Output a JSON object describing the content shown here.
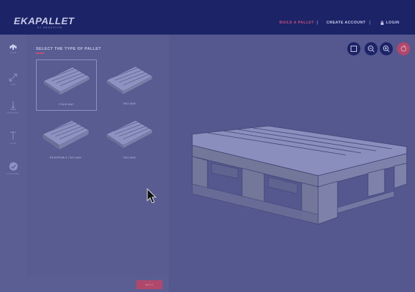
{
  "header": {
    "logo": "EKAPALLET",
    "logo_sub": "BY BRAGSTON",
    "nav": {
      "build": "BUILD A PALLET",
      "create": "CREATE ACCOUNT",
      "login": "LOGIN",
      "separator": "|"
    }
  },
  "sidebar": {
    "items": [
      {
        "label": "TYPE",
        "icon": "pallet-type-icon"
      },
      {
        "label": "SIZE",
        "icon": "resize-arrows-icon"
      },
      {
        "label": "MATERIAL",
        "icon": "thickness-icon"
      },
      {
        "label": "LOAD",
        "icon": "height-icon"
      },
      {
        "label": "FINISHING",
        "icon": "check-circle-icon"
      }
    ]
  },
  "panel": {
    "title": "SELECT THE TYPE OF PALLET",
    "options": [
      {
        "label": "FOUR-WAY"
      },
      {
        "label": "TWO-WAY"
      },
      {
        "label": "REVERSIBLE TWO-WAY"
      },
      {
        "label": "TWO-WAY"
      }
    ]
  },
  "footer": {
    "next_label": "NEXT"
  },
  "colors": {
    "header": "#1d2367",
    "accent": "#b0486c",
    "overlay": "#54588e"
  }
}
